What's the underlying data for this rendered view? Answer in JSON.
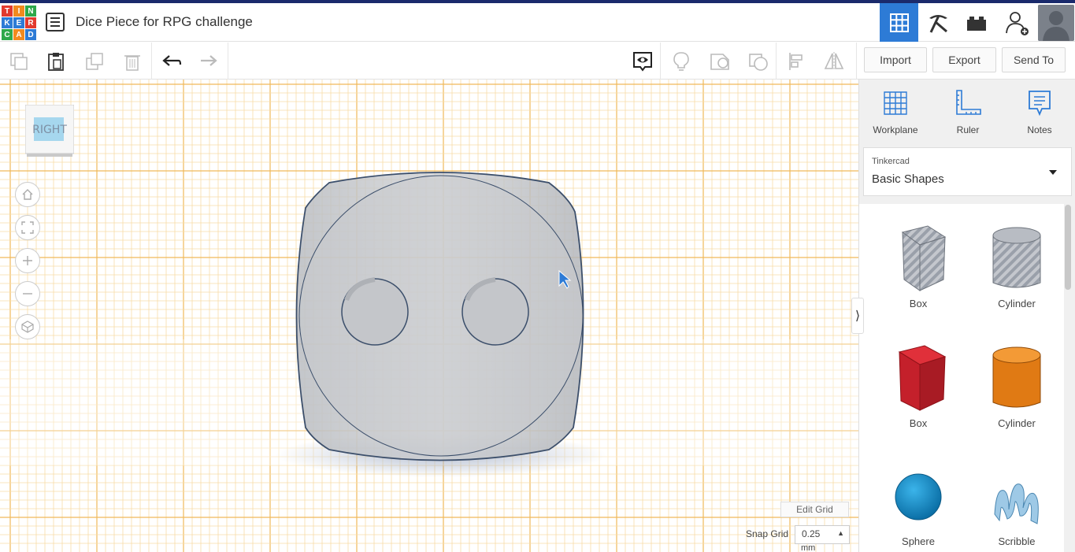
{
  "app": {
    "logo_letters": [
      "T",
      "I",
      "N",
      "K",
      "E",
      "R",
      "C",
      "A",
      "D"
    ],
    "logo_colors": [
      "#e23a2e",
      "#f28a1e",
      "#2ea84a",
      "#2d7bd6",
      "#2d7bd6",
      "#e23a2e",
      "#2ea84a",
      "#f28a1e",
      "#2d7bd6"
    ],
    "title": "Dice Piece for RPG challenge",
    "accent": "#2d7bd6"
  },
  "header": {
    "icons": [
      "grid-view-icon",
      "pickaxe-icon",
      "bricks-icon",
      "add-user-icon"
    ]
  },
  "toolbar": {
    "import_label": "Import",
    "export_label": "Export",
    "sendto_label": "Send To"
  },
  "canvas": {
    "viewcube_label": "RIGHT",
    "edit_grid_label": "Edit Grid",
    "snap_grid_label": "Snap Grid",
    "snap_value": "0.25",
    "snap_unit": "mm"
  },
  "panel": {
    "tools": [
      {
        "label": "Workplane",
        "icon": "workplane-icon"
      },
      {
        "label": "Ruler",
        "icon": "ruler-icon"
      },
      {
        "label": "Notes",
        "icon": "notes-icon"
      }
    ],
    "library_source": "Tinkercad",
    "library_name": "Basic Shapes",
    "shapes": [
      {
        "label": "Box",
        "kind": "box-hole"
      },
      {
        "label": "Cylinder",
        "kind": "cylinder-hole"
      },
      {
        "label": "Box",
        "kind": "box-solid"
      },
      {
        "label": "Cylinder",
        "kind": "cylinder-solid"
      },
      {
        "label": "Sphere",
        "kind": "sphere"
      },
      {
        "label": "Scribble",
        "kind": "scribble"
      }
    ]
  }
}
